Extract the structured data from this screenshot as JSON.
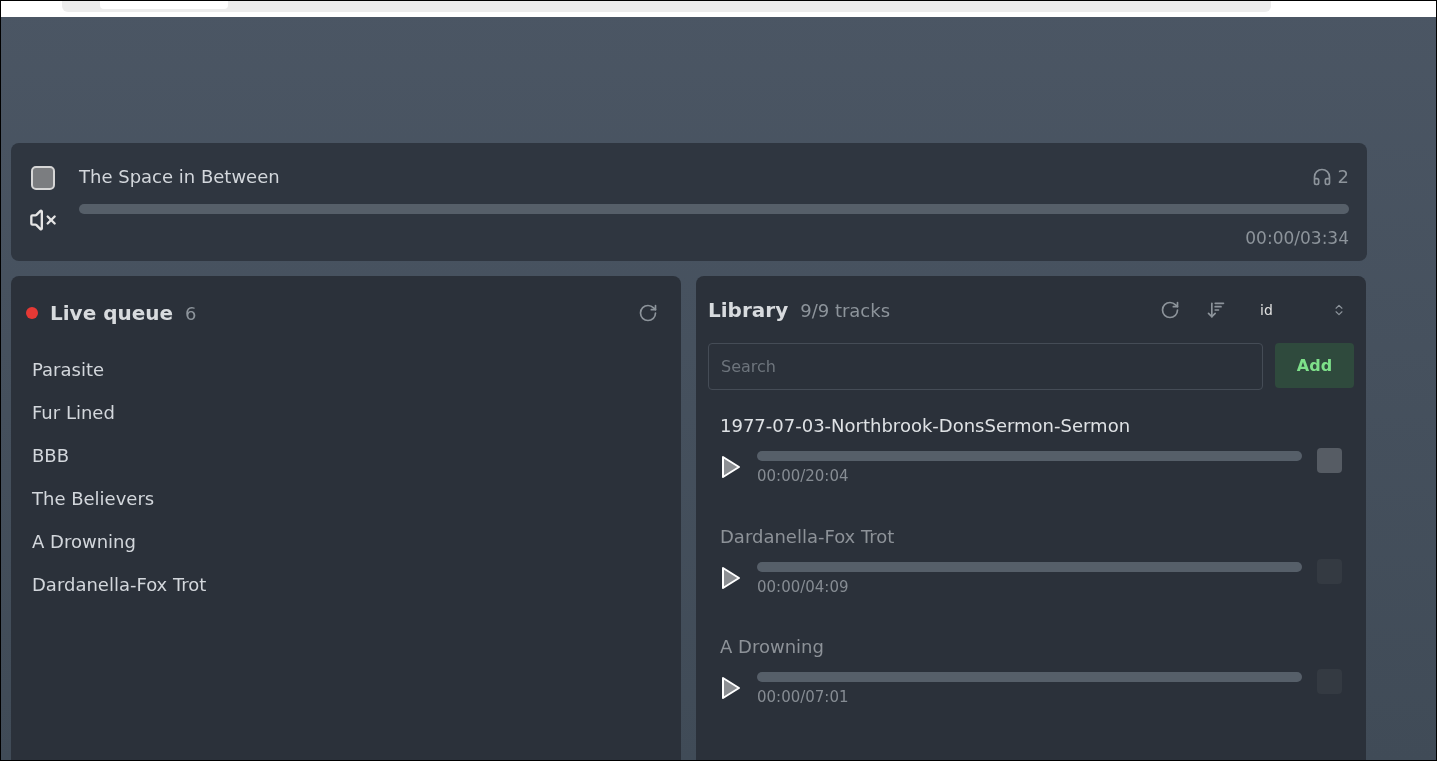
{
  "player": {
    "title": "The Space in Between",
    "muted": true,
    "listeners": "2",
    "time": "00:00/03:34"
  },
  "queue": {
    "title": "Live queue",
    "live": true,
    "count": "6",
    "items": [
      "Parasite",
      "Fur Lined",
      "BBB",
      "The Believers",
      "A Drowning",
      "Dardanella-Fox Trot"
    ]
  },
  "library": {
    "title": "Library",
    "count": "9/9 tracks",
    "sort": "id",
    "search": {
      "placeholder": "Search"
    },
    "add_button": "Add",
    "tracks": [
      {
        "title": "1977-07-03-Northbrook-DonsSermon-Sermon",
        "time": "00:00/20:04",
        "selected": true
      },
      {
        "title": "Dardanella-Fox Trot",
        "time": "00:00/04:09",
        "selected": false
      },
      {
        "title": "A Drowning",
        "time": "00:00/07:01",
        "selected": false
      }
    ]
  }
}
